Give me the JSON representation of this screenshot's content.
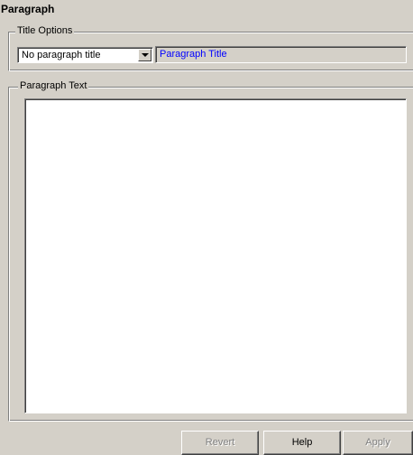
{
  "panel_title": "Paragraph",
  "title_options": {
    "legend": "Title Options",
    "select_value": "No paragraph title",
    "title_field_value": "Paragraph Title"
  },
  "paragraph_text": {
    "legend": "Paragraph Text",
    "value": ""
  },
  "buttons": {
    "revert": "Revert",
    "help": "Help",
    "apply": "Apply"
  }
}
